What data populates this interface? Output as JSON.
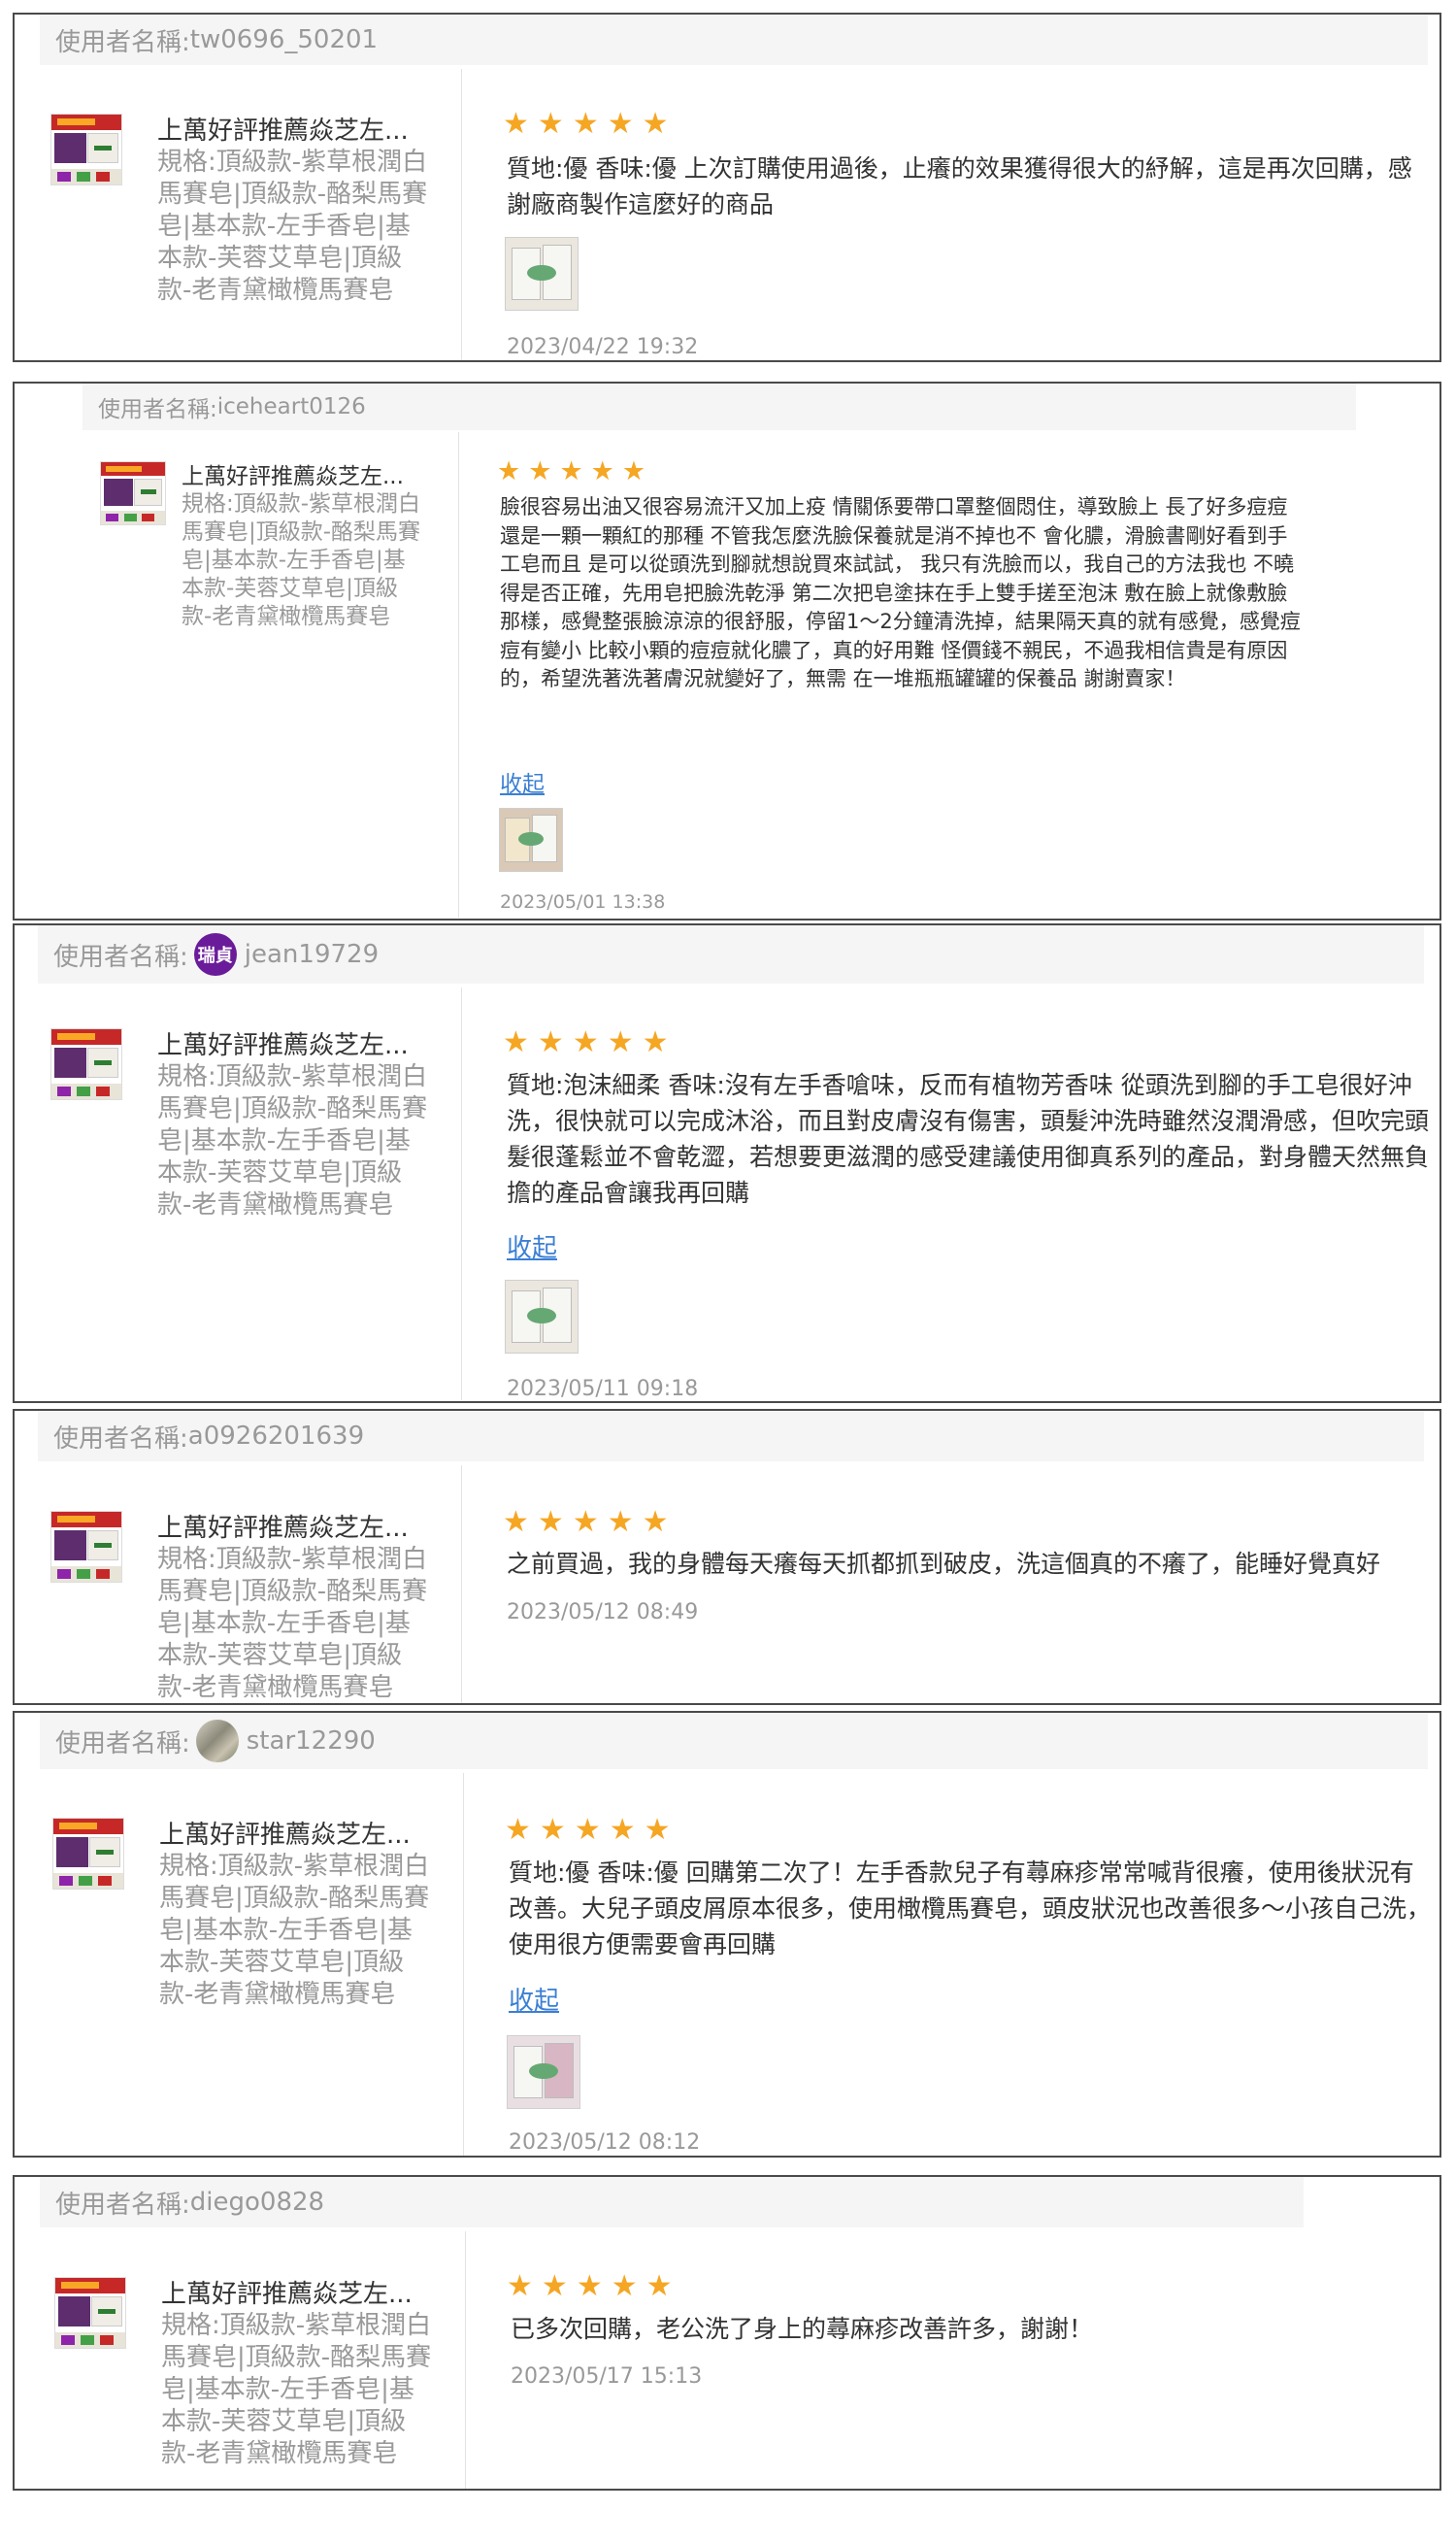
{
  "reviews": [
    {
      "username_label": "使用者名稱:",
      "username": "tw0696_50201",
      "product_name": "上萬好評推薦焱芝左...",
      "product_spec": "規格:頂級款-紫草根潤白馬賽皂|頂級款-酪梨馬賽皂|基本款-左手香皂|基本款-芙蓉艾草皂|頂級款-老青黛橄欖馬賽皂",
      "stars": "★",
      "rating": 5,
      "text": "質地:優 香味:優 上次訂購使用過後，止癢的效果獲得很大的紓解，這是再次回購，感謝廠商製作這麼好的商品",
      "timestamp": "2023/04/22 19:32"
    },
    {
      "username_label": "使用者名稱:",
      "username": "iceheart0126",
      "product_name": "上萬好評推薦焱芝左...",
      "product_spec": "規格:頂級款-紫草根潤白馬賽皂|頂級款-酪梨馬賽皂|基本款-左手香皂|基本款-芙蓉艾草皂|頂級款-老青黛橄欖馬賽皂",
      "stars": "★",
      "rating": 5,
      "text": "臉很容易出油又很容易流汗又加上疫 情關係要帶口罩整個悶住，導致臉上 長了好多痘痘還是一顆一顆紅的那種 不管我怎麼洗臉保養就是消不掉也不 會化膿，滑臉書剛好看到手工皂而且 是可以從頭洗到腳就想說買來試試， 我只有洗臉而以，我自己的方法我也 不曉得是否正確，先用皂把臉洗乾淨 第二次把皂塗抹在手上雙手搓至泡沫 敷在臉上就像敷臉那樣，感覺整張臉涼涼的很舒服，停留1～2分鐘清洗掉，結果隔天真的就有感覺，感覺痘痘有變小 比較小顆的痘痘就化膿了，真的好用難 怪價錢不親民，不過我相信貴是有原因 的，希望洗著洗著膚況就變好了，無需 在一堆瓶瓶罐罐的保養品 謝謝賣家！",
      "collapse": "收起",
      "timestamp": "2023/05/01 13:38"
    },
    {
      "username_label": "使用者名稱:",
      "username": "jean19729",
      "avatar_text": "瑞貞",
      "product_name": "上萬好評推薦焱芝左...",
      "product_spec": "規格:頂級款-紫草根潤白馬賽皂|頂級款-酪梨馬賽皂|基本款-左手香皂|基本款-芙蓉艾草皂|頂級款-老青黛橄欖馬賽皂",
      "stars": "★",
      "rating": 5,
      "text": "質地:泡沫細柔 香味:沒有左手香嗆味，反而有植物芳香味 從頭洗到腳的手工皂很好沖洗，很快就可以完成沐浴，而且對皮膚沒有傷害，頭髮沖洗時雖然沒潤滑感，但吹完頭髮很蓬鬆並不會乾澀，若想要更滋潤的感受建議使用御真系列的產品，對身體天然無負擔的產品會讓我再回購",
      "collapse": "收起",
      "timestamp": "2023/05/11 09:18"
    },
    {
      "username_label": "使用者名稱:",
      "username": "a0926201639",
      "product_name": "上萬好評推薦焱芝左...",
      "product_spec": "規格:頂級款-紫草根潤白馬賽皂|頂級款-酪梨馬賽皂|基本款-左手香皂|基本款-芙蓉艾草皂|頂級款-老青黛橄欖馬賽皂",
      "stars": "★",
      "rating": 5,
      "text": "之前買過，我的身體每天癢每天抓都抓到破皮，洗這個真的不癢了，能睡好覺真好",
      "timestamp": "2023/05/12 08:49"
    },
    {
      "username_label": "使用者名稱:",
      "username": "star12290",
      "product_name": "上萬好評推薦焱芝左...",
      "product_spec": "規格:頂級款-紫草根潤白馬賽皂|頂級款-酪梨馬賽皂|基本款-左手香皂|基本款-芙蓉艾草皂|頂級款-老青黛橄欖馬賽皂",
      "stars": "★",
      "rating": 5,
      "text": "質地:優 香味:優 回購第二次了！左手香款兒子有蕁麻疹常常喊背很癢，使用後狀況有改善。大兒子頭皮屑原本很多，使用橄欖馬賽皂，頭皮狀況也改善很多～小孩自己洗，使用很方便需要會再回購",
      "collapse": "收起",
      "timestamp": "2023/05/12 08:12"
    },
    {
      "username_label": "使用者名稱:",
      "username": "diego0828",
      "product_name": "上萬好評推薦焱芝左...",
      "product_spec": "規格:頂級款-紫草根潤白馬賽皂|頂級款-酪梨馬賽皂|基本款-左手香皂|基本款-芙蓉艾草皂|頂級款-老青黛橄欖馬賽皂",
      "stars": "★",
      "rating": 5,
      "text": "已多次回購，老公洗了身上的蕁麻疹改善許多，謝謝！",
      "timestamp": "2023/05/17 15:13"
    }
  ]
}
